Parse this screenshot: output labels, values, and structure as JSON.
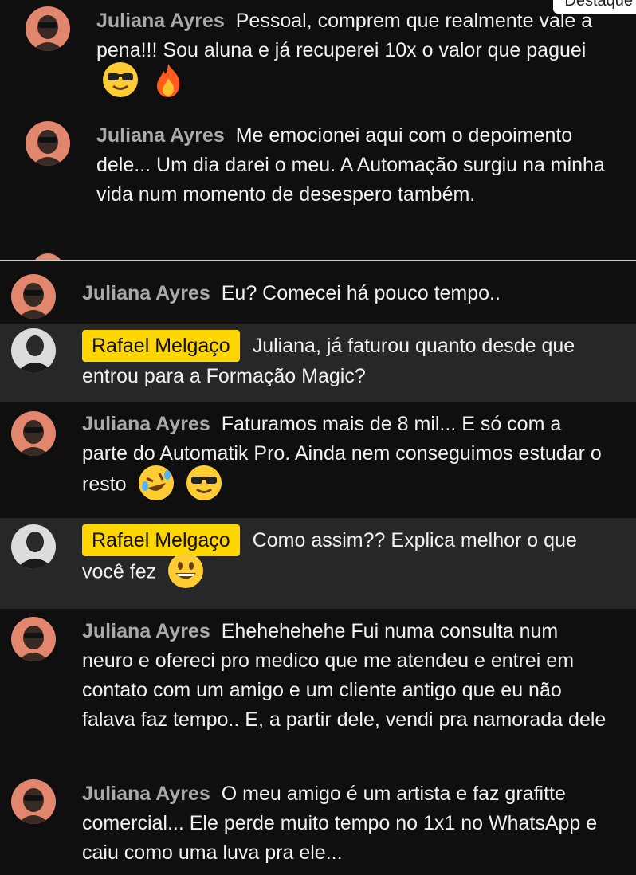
{
  "top_tag": "Destaque",
  "top_messages": [
    {
      "author": "Juliana Ayres",
      "text": "Pessoal, comprem que realmente vale a pena!!! Sou aluna e já recuperei 10x o valor que paguei",
      "emojis": [
        "smiling-face-with-sunglasses",
        "fire"
      ]
    },
    {
      "author": "Juliana Ayres",
      "text": "Me emocionei aqui com o depoimento dele... Um dia darei o meu. A Automação surgiu na minha vida num momento de desespero também.",
      "emojis": []
    }
  ],
  "messages": [
    {
      "author": "Juliana Ayres",
      "text": "Eu? Comecei há pouco tempo..",
      "highlight": false,
      "chip": false,
      "emojis": []
    },
    {
      "author": "Rafael Melgaço",
      "text": "Juliana, já faturou quanto desde que entrou para a Formação Magic?",
      "highlight": true,
      "chip": true,
      "emojis": []
    },
    {
      "author": "Juliana Ayres",
      "text": "Faturamos mais de 8 mil... E só com a parte do Automatik Pro. Ainda nem conseguimos estudar o resto",
      "highlight": false,
      "chip": false,
      "emojis": [
        "rolling-on-the-floor-laughing",
        "smiling-face-with-sunglasses"
      ]
    },
    {
      "author": "Rafael Melgaço",
      "text": "Como assim?? Explica melhor o que você fez",
      "highlight": true,
      "chip": true,
      "emojis": [
        "grinning-face"
      ]
    },
    {
      "author": "Juliana Ayres",
      "text": "Ehehehehehe Fui numa consulta num neuro e ofereci pro medico que me atendeu e entrei em contato com um amigo e um cliente antigo que eu não falava faz tempo.. E, a partir dele, vendi pra namorada dele",
      "highlight": false,
      "chip": false,
      "emojis": []
    },
    {
      "author": "Juliana Ayres",
      "text": "O meu amigo é um artista e faz grafitte comercial... Ele perde muito tempo no 1x1 no WhatsApp e caiu como uma luva pra ele...",
      "highlight": false,
      "chip": false,
      "emojis": []
    }
  ]
}
